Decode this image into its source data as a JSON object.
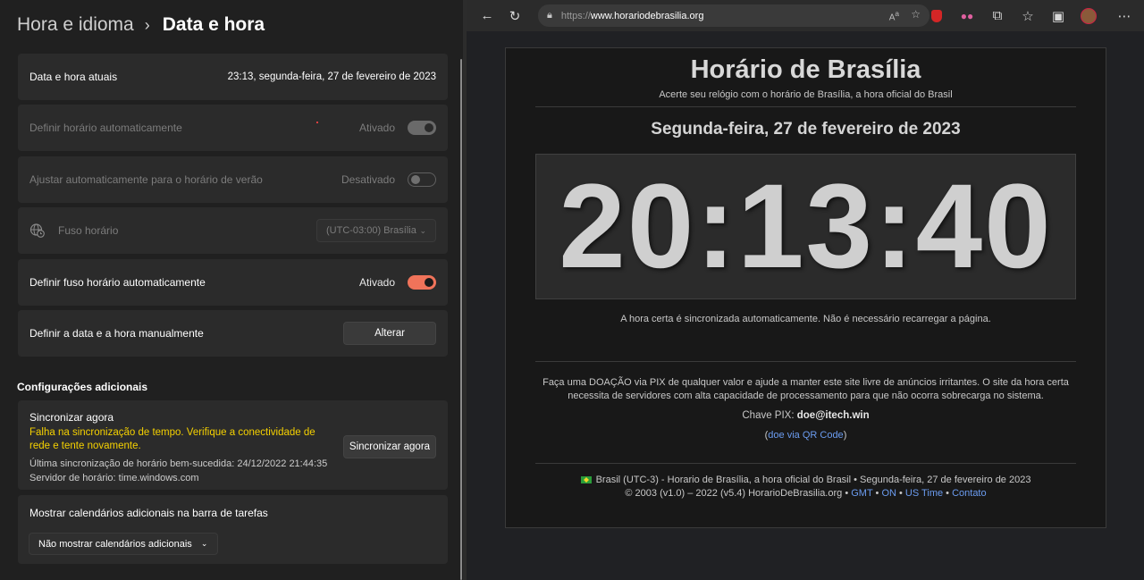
{
  "settings": {
    "breadcrumb": {
      "parent": "Hora e idioma",
      "current": "Data e hora"
    },
    "current_datetime": {
      "label": "Data e hora atuais",
      "value": "23:13, segunda-feira, 27 de fevereiro de 2023"
    },
    "auto_time": {
      "label": "Definir horário automaticamente",
      "status": "Ativado",
      "on": true,
      "enabled": false
    },
    "dst": {
      "label": "Ajustar automaticamente para o horário de verão",
      "status": "Desativado",
      "on": false,
      "enabled": false
    },
    "timezone": {
      "label": "Fuso horário",
      "value": "(UTC-03:00) Brasília"
    },
    "auto_timezone": {
      "label": "Definir fuso horário automaticamente",
      "status": "Ativado",
      "on": true
    },
    "manual": {
      "label": "Definir a data e a hora manualmente",
      "button": "Alterar"
    },
    "additional_title": "Configurações adicionais",
    "sync": {
      "title": "Sincronizar agora",
      "warning": "Falha na sincronização de tempo. Verifique a conectividade de rede e tente novamente.",
      "last_sync": "Última sincronização de horário bem-sucedida: 24/12/2022 21:44:35",
      "server": "Servidor de horário: time.windows.com",
      "button": "Sincronizar agora"
    },
    "calendars": {
      "label": "Mostrar calendários adicionais na barra de tarefas",
      "value": "Não mostrar calendários adicionais"
    }
  },
  "browser": {
    "url_prefix": "https://",
    "url_host": "www.horariodebrasilia.org",
    "accent_colors": {
      "toggle_on": "#f0735a",
      "warning": "#f5d100",
      "link": "#6b9cf0"
    }
  },
  "site": {
    "title": "Horário de Brasília",
    "subtitle": "Acerte seu relógio com o horário de Brasília, a hora oficial do Brasil",
    "date": "Segunda-feira, 27 de fevereiro de 2023",
    "clock": "20:13:40",
    "note": "A hora certa é sincronizada automaticamente. Não é necessário recarregar a página.",
    "donate": "Faça uma DOAÇÃO via PIX de qualquer valor e ajude a manter este site livre de anúncios irritantes. O site da hora certa necessita de servidores com alta capacidade de processamento para que não ocorra sobrecarga no sistema.",
    "pix_label": "Chave PIX:",
    "pix_key": "doe@itech.win",
    "qr_link": "doe via QR Code",
    "footer_line1": "Brasil (UTC-3) - Horario de Brasília, a hora oficial do Brasil • Segunda-feira, 27 de fevereiro de 2023",
    "footer_line2_text": "© 2003 (v1.0) – 2022 (v5.4) HorarioDeBrasilia.org •",
    "footer_links": [
      "GMT",
      "ON",
      "US Time",
      "Contato"
    ]
  }
}
